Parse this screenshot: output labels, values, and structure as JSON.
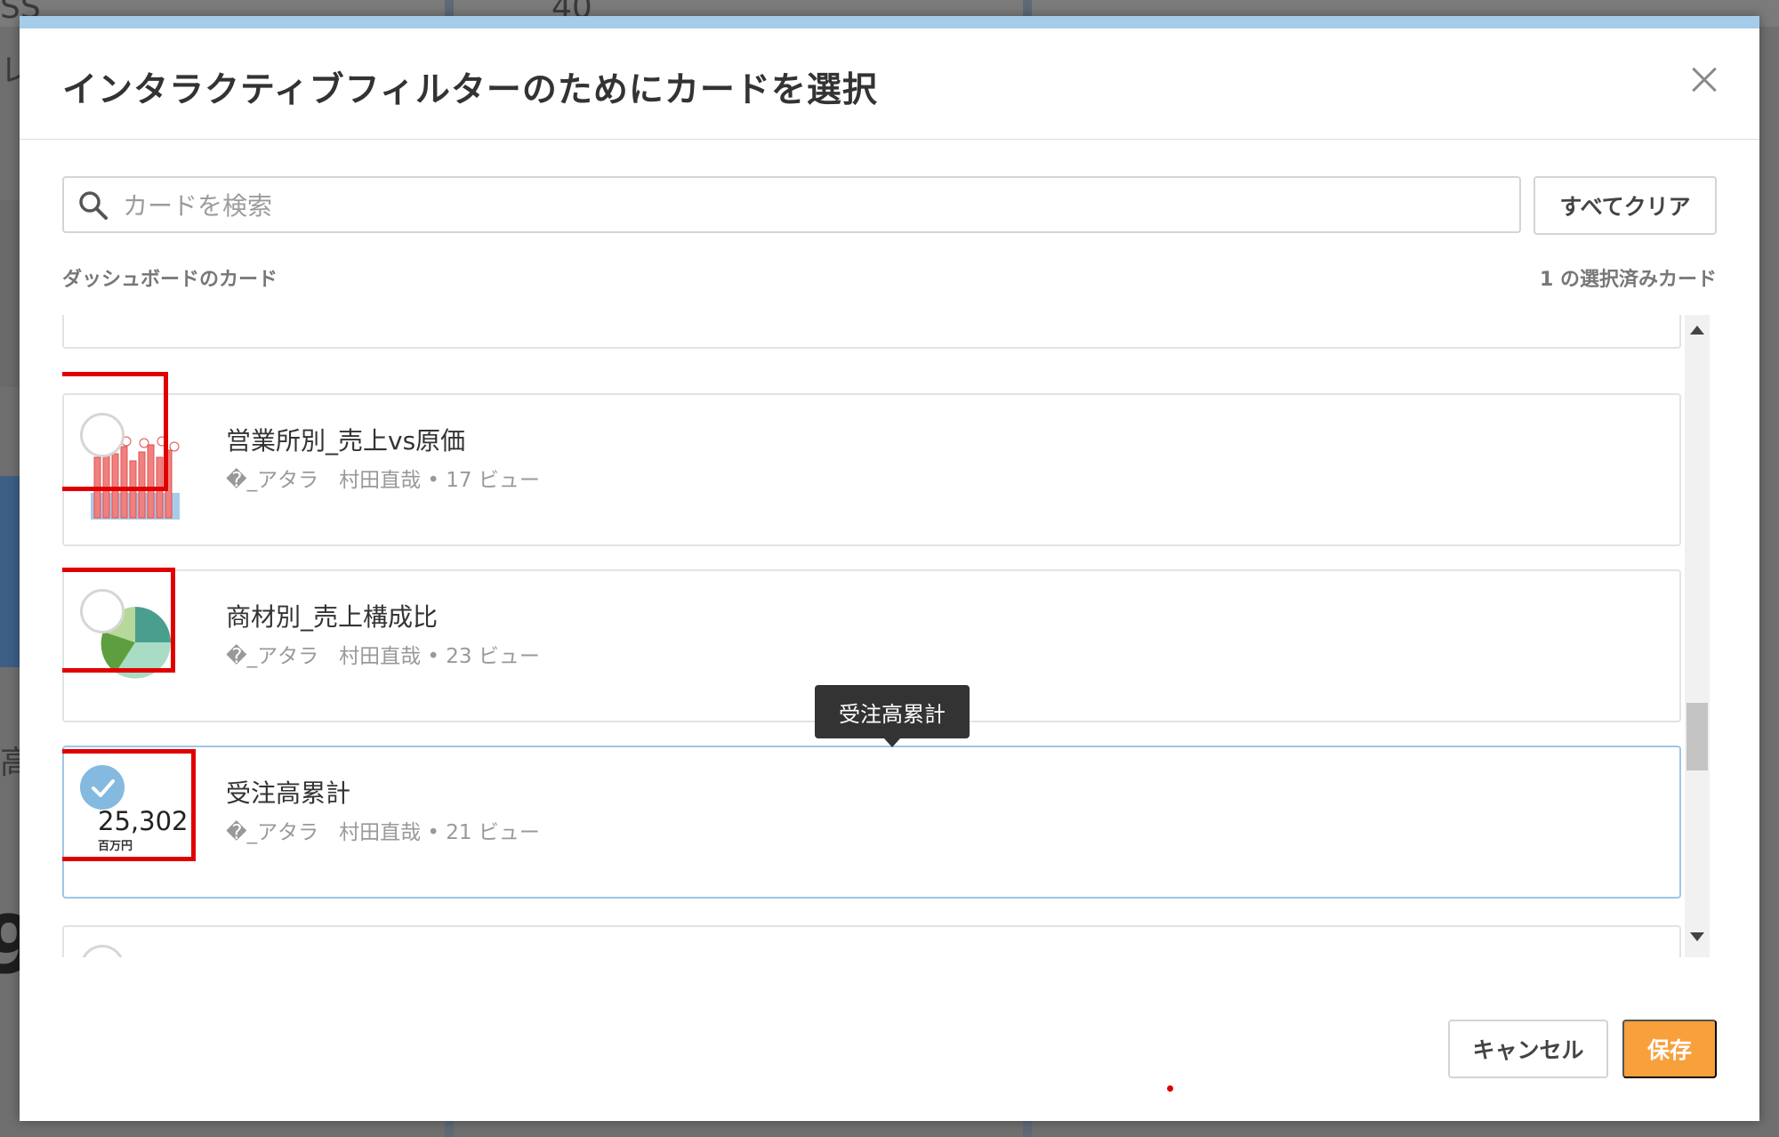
{
  "background": {
    "fragment_top_left": "SS",
    "fragment_top_num": "40",
    "fragment_left_1": "レ",
    "fragment_left_2": "高",
    "fragment_big": "9"
  },
  "dialog": {
    "title": "インタラクティブフィルターのためにカードを選択",
    "search_placeholder": "カードを検索",
    "clear_all_label": "すべてクリア",
    "section_label": "ダッシュボードのカード",
    "selected_count": "1 の選択済みカード",
    "cards": [
      {
        "title": "営業所別_売上vs原価",
        "meta": "�_アタラ　村田直哉 • 17 ビュー",
        "selected": false,
        "thumbnail": "bar-chart"
      },
      {
        "title": "商材別_売上構成比",
        "meta": "�_アタラ　村田直哉 • 23 ビュー",
        "selected": false,
        "thumbnail": "pie-chart"
      },
      {
        "title": "受注高累計",
        "meta": "�_アタラ　村田直哉 • 21 ビュー",
        "selected": true,
        "thumbnail": "kpi",
        "kpi_value": "25,302",
        "kpi_unit": "百万円"
      }
    ],
    "tooltip": "受注高累計",
    "cancel_label": "キャンセル",
    "save_label": "保存"
  },
  "colors": {
    "accent_top_bar": "#a5cce8",
    "save_button": "#f7a03c",
    "highlight": "#e00000",
    "check": "#84b9e0"
  }
}
